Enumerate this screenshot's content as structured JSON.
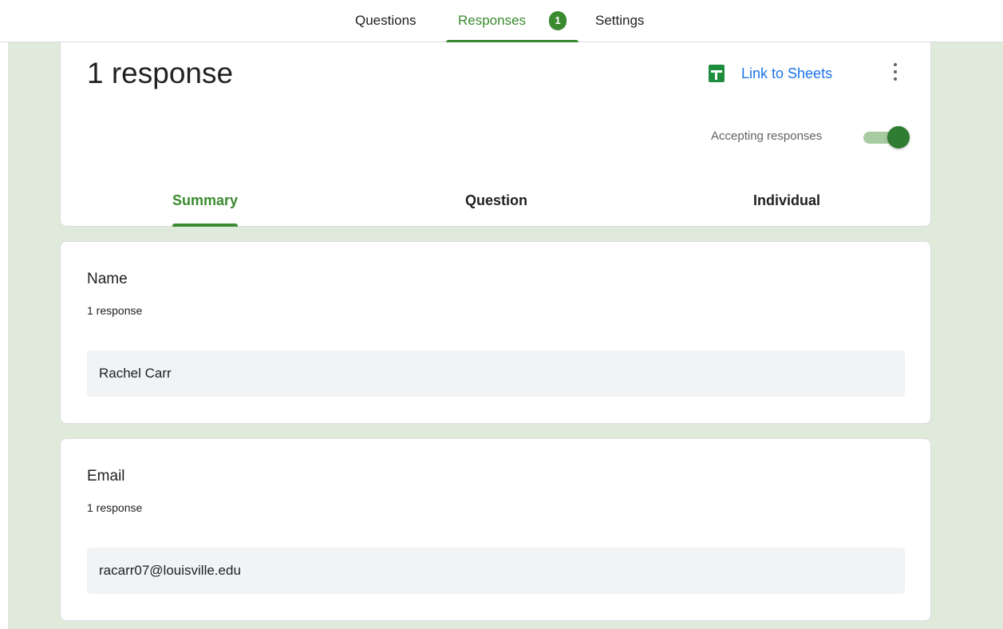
{
  "nav": {
    "questions": "Questions",
    "responses": "Responses",
    "responses_badge": "1",
    "settings": "Settings"
  },
  "header": {
    "title": "1 response",
    "link_sheets": "Link to Sheets",
    "accepting_label": "Accepting responses",
    "accepting_on": true
  },
  "subtabs": {
    "summary": "Summary",
    "question": "Question",
    "individual": "Individual"
  },
  "questions": [
    {
      "title": "Name",
      "count": "1 response",
      "answer": "Rachel Carr"
    },
    {
      "title": "Email",
      "count": "1 response",
      "answer": "racarr07@louisville.edu"
    }
  ],
  "colors": {
    "accent": "#3a8a2f",
    "background": "#dfeadb",
    "link": "#1a73e8"
  }
}
